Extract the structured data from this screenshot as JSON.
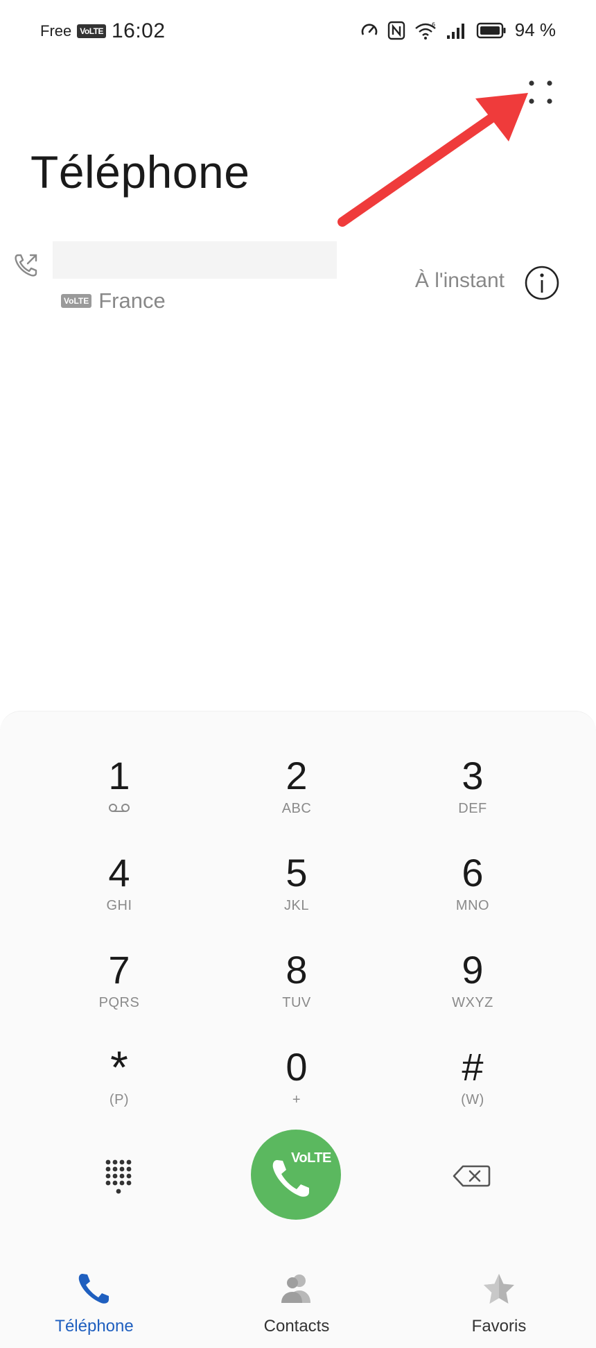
{
  "status_bar": {
    "carrier": "Free",
    "volte_badge": "VoLTE",
    "time": "16:02",
    "battery_percent": "94 %",
    "icons": [
      "data-saver-icon",
      "nfc-icon",
      "wifi-icon",
      "signal-icon",
      "battery-icon"
    ]
  },
  "header": {
    "title": "Téléphone",
    "more_icon": "more-dots-icon"
  },
  "call_log": [
    {
      "type_icon": "outgoing-call-icon",
      "number": "",
      "badge": "VoLTE",
      "country": "France",
      "time": "À l'instant",
      "info_icon": "info-icon"
    }
  ],
  "dialpad": {
    "keys": [
      {
        "digit": "1",
        "letters": "",
        "sub_icon": "voicemail-icon"
      },
      {
        "digit": "2",
        "letters": "ABC"
      },
      {
        "digit": "3",
        "letters": "DEF"
      },
      {
        "digit": "4",
        "letters": "GHI"
      },
      {
        "digit": "5",
        "letters": "JKL"
      },
      {
        "digit": "6",
        "letters": "MNO"
      },
      {
        "digit": "7",
        "letters": "PQRS"
      },
      {
        "digit": "8",
        "letters": "TUV"
      },
      {
        "digit": "9",
        "letters": "WXYZ"
      },
      {
        "digit": "*",
        "letters": "(P)"
      },
      {
        "digit": "0",
        "letters": "+"
      },
      {
        "digit": "#",
        "letters": "(W)"
      }
    ],
    "call_button_label": "VoLTE",
    "call_button_color": "#5bb85f",
    "toggle_icon": "dialpad-grid-icon",
    "backspace_icon": "backspace-icon"
  },
  "bottom_nav": {
    "items": [
      {
        "label": "Téléphone",
        "icon": "phone-icon",
        "active": true
      },
      {
        "label": "Contacts",
        "icon": "contacts-icon",
        "active": false
      },
      {
        "label": "Favoris",
        "icon": "star-icon",
        "active": false
      }
    ],
    "active_color": "#1f5fbf"
  },
  "annotation": {
    "arrow_color": "#ef3b3b"
  }
}
